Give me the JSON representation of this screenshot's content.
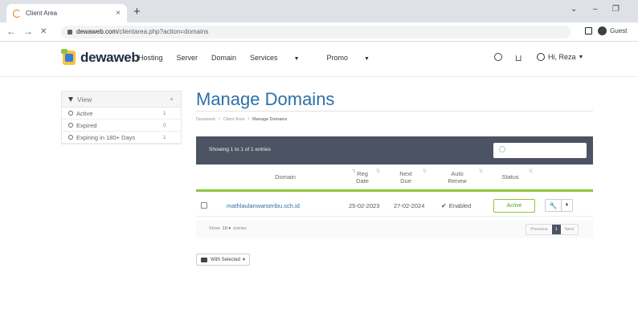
{
  "browser": {
    "tab_title": "Client Area",
    "tab_close": "×",
    "new_tab": "+",
    "url_host": "dewaweb.com",
    "url_path": "/clientarea.php?action=domains",
    "profile_label": "Guest",
    "back": "←",
    "forward": "→",
    "reload": "✕",
    "win_minimize": "–",
    "win_restore": "❐",
    "win_menu": "⌄"
  },
  "header": {
    "logo_text": "dewaweb",
    "nav": [
      {
        "label": "Hosting"
      },
      {
        "label": "Server"
      },
      {
        "label": "Domain"
      },
      {
        "label": "Services"
      },
      {
        "label": "Promo"
      }
    ],
    "cart_icon": "cart",
    "user_greeting": "Hi, Reza"
  },
  "sidebar": {
    "title": "View",
    "items": [
      {
        "label": "Active",
        "count": "1"
      },
      {
        "label": "Expired",
        "count": "0"
      },
      {
        "label": "Expiring in 180+ Days",
        "count": "1"
      }
    ]
  },
  "main": {
    "title": "Manage Domains",
    "breadcrumb": [
      "Dewaweb",
      "Client Area",
      "Manage Domains"
    ],
    "showing_text": "Showing 1 to 1 of 1 entries",
    "columns": [
      "Domain",
      "Reg Date",
      "Next Due",
      "Auto Renew",
      "Status"
    ],
    "rows": [
      {
        "domain": "mathlaulanwarseribu.sch.id",
        "reg_date": "25-02-2023",
        "next_due": "27-02-2024",
        "auto_renew": "Enabled",
        "status": "Active"
      }
    ],
    "show_label": "Show",
    "show_value": "10",
    "entries_label": "entries",
    "pagination": {
      "previous": "Previous",
      "current": "1",
      "next": "Next"
    },
    "with_selected": "With Selected"
  },
  "colors": {
    "accent_blue": "#2e6fa8",
    "table_header": "#4c5362",
    "status_green": "#8dc63f"
  }
}
